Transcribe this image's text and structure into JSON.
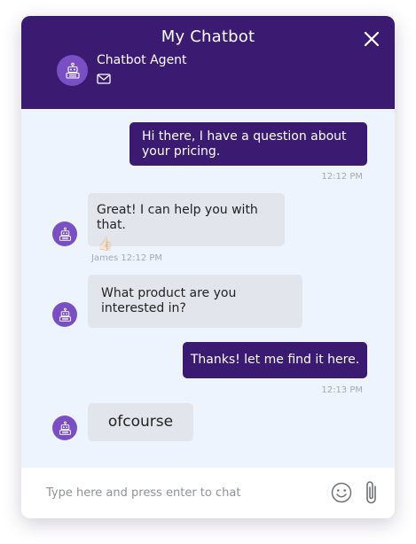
{
  "header": {
    "title": "My Chatbot",
    "agent_name": "Chatbot Agent"
  },
  "messages": [
    {
      "sender": "user",
      "text": "Hi there, I have a question about your pricing.",
      "time": "12:12 PM"
    },
    {
      "sender": "bot",
      "text": "Great! I can help you with that.",
      "emoji": "👍🏻",
      "meta": "James 12:12 PM"
    },
    {
      "sender": "bot",
      "text": "What product are you interested in?"
    },
    {
      "sender": "user",
      "text": "Thanks! let me find it here.",
      "time": "12:13 PM"
    },
    {
      "sender": "bot",
      "text": "ofcourse"
    }
  ],
  "input": {
    "placeholder": "Type here and press enter to chat",
    "value": ""
  },
  "icons": {
    "close": "close-icon",
    "mail": "mail-icon",
    "avatar": "robot-icon",
    "emoji": "smiley-icon",
    "attach": "paperclip-icon"
  },
  "colors": {
    "header_bg": "#3b1a72",
    "user_bubble": "#3b1a72",
    "bot_bubble": "#e2e5ec",
    "avatar_bg": "#7b4fc4",
    "chat_bg": "#eef4fd"
  }
}
